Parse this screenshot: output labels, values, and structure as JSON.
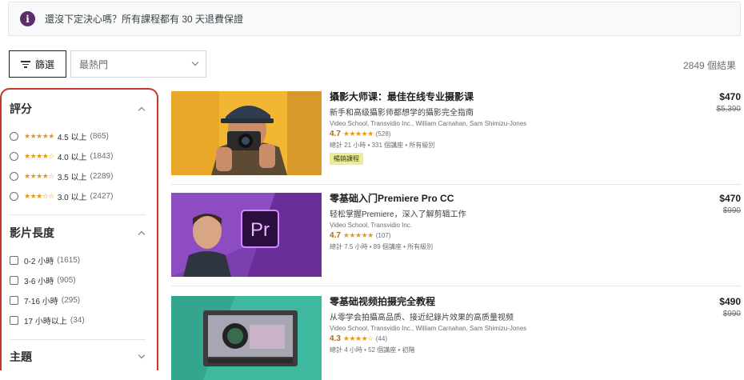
{
  "notice": {
    "icon": "info-icon",
    "text": "還沒下定決心嗎？所有課程都有 30 天退費保證"
  },
  "toolbar": {
    "filter_label": "篩選",
    "sort_value": "最熱門",
    "results_count": "2849 個結果"
  },
  "sidebar": {
    "rating": {
      "heading": "評分",
      "options": [
        {
          "stars": "★★★★★",
          "label": "4.5 以上",
          "count": "(865)"
        },
        {
          "stars": "★★★★☆",
          "label": "4.0 以上",
          "count": "(1843)"
        },
        {
          "stars": "★★★★☆",
          "label": "3.5 以上",
          "count": "(2289)"
        },
        {
          "stars": "★★★☆☆",
          "label": "3.0 以上",
          "count": "(2427)"
        }
      ]
    },
    "duration": {
      "heading": "影片長度",
      "options": [
        {
          "label": "0-2 小時",
          "count": "(1615)"
        },
        {
          "label": "3-6 小時",
          "count": "(905)"
        },
        {
          "label": "7-16 小時",
          "count": "(295)"
        },
        {
          "label": "17 小時以上",
          "count": "(34)"
        }
      ]
    },
    "topic": {
      "heading": "主題"
    }
  },
  "courses": [
    {
      "title": "攝影大师课：最佳在线专业摄影课",
      "subtitle": "新手和高级攝影师都想学的攝影完全指南",
      "instructors": "Video School, Transvidio Inc., William Carnahan, Sam Shimizu-Jones",
      "rating": "4.7",
      "stars": "★★★★★",
      "reviews": "(528)",
      "meta": "總計 21 小時 • 331 個講座 • 所有級別",
      "badge": "暢銷課程",
      "price": "$470",
      "original_price": "$5,390"
    },
    {
      "title": "零基础入门Premiere Pro CC",
      "subtitle": "轻松掌握Premiere，深入了解剪辑工作",
      "instructors": "Video School, Transvidio Inc.",
      "rating": "4.7",
      "stars": "★★★★★",
      "reviews": "(107)",
      "meta": "總計 7.5 小時 • 89 個講座 • 所有級別",
      "price": "$470",
      "original_price": "$990",
      "thumb_text": "Pr"
    },
    {
      "title": "零基础视频拍摄完全教程",
      "subtitle": "从零学会拍攝高品质、接近纪錄片效果的高质量视频",
      "instructors": "Video School, Transvidio Inc., William Carnahan, Sam Shimizu-Jones",
      "rating": "4.3",
      "stars": "★★★★☆",
      "reviews": "(44)",
      "meta": "總計 4 小時 • 52 個講座 • 初階",
      "price": "$490",
      "original_price": "$990"
    }
  ],
  "colors": {
    "accent": "#5b2d6b",
    "highlight_border": "#c0392b",
    "star": "#e59819",
    "rating_text": "#b4690e"
  }
}
